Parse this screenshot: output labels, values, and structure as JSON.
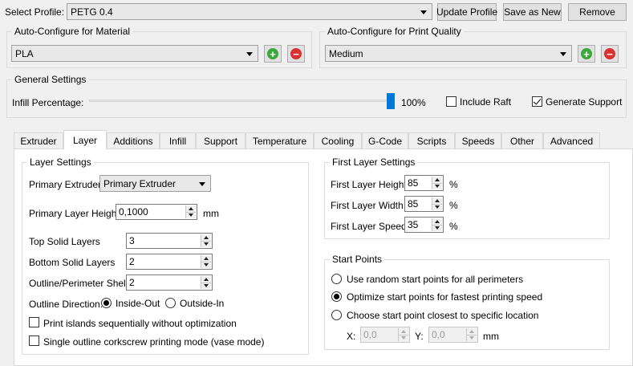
{
  "profile": {
    "label": "Select Profile:",
    "selected": "PETG 0.4",
    "update_button": "Update Profile",
    "save_as_new_button": "Save as New",
    "remove_button": "Remove"
  },
  "material": {
    "group_title": "Auto-Configure for Material",
    "selected": "PLA"
  },
  "print_quality": {
    "group_title": "Auto-Configure for Print Quality",
    "selected": "Medium"
  },
  "general": {
    "group_title": "General Settings",
    "infill_label": "Infill Percentage:",
    "infill_value_text": "100%",
    "infill_fraction": 1.0,
    "include_raft_label": "Include Raft",
    "include_raft_checked": false,
    "generate_support_label": "Generate Support",
    "generate_support_checked": true
  },
  "tabs": [
    {
      "label": "Extruder"
    },
    {
      "label": "Layer",
      "active": true
    },
    {
      "label": "Additions"
    },
    {
      "label": "Infill"
    },
    {
      "label": "Support"
    },
    {
      "label": "Temperature"
    },
    {
      "label": "Cooling"
    },
    {
      "label": "G-Code"
    },
    {
      "label": "Scripts"
    },
    {
      "label": "Speeds"
    },
    {
      "label": "Other"
    },
    {
      "label": "Advanced"
    }
  ],
  "layer_settings": {
    "group_title": "Layer Settings",
    "primary_extruder_label": "Primary Extruder",
    "primary_extruder_value": "Primary Extruder",
    "primary_layer_height_label": "Primary Layer Height",
    "primary_layer_height_value": "0,1000",
    "primary_layer_height_unit": "mm",
    "top_solid_layers_label": "Top Solid Layers",
    "top_solid_layers_value": "3",
    "bottom_solid_layers_label": "Bottom Solid Layers",
    "bottom_solid_layers_value": "2",
    "outline_shells_label": "Outline/Perimeter Shells",
    "outline_shells_value": "2",
    "outline_direction_label": "Outline Direction:",
    "inside_out_label": "Inside-Out",
    "outside_in_label": "Outside-In",
    "print_islands_label": "Print islands sequentially without optimization",
    "vase_mode_label": "Single outline corkscrew printing mode (vase mode)"
  },
  "first_layer": {
    "group_title": "First Layer Settings",
    "height_label": "First Layer Height",
    "height_value": "85",
    "width_label": "First Layer Width",
    "width_value": "85",
    "speed_label": "First Layer Speed",
    "speed_value": "35",
    "unit": "%"
  },
  "start_points": {
    "group_title": "Start Points",
    "option_random": "Use random start points for all perimeters",
    "option_optimize": "Optimize start points for fastest printing speed",
    "option_closest": "Choose start point closest to specific location",
    "x_label": "X:",
    "x_value": "0,0",
    "y_label": "Y:",
    "y_value": "0,0",
    "unit": "mm"
  }
}
